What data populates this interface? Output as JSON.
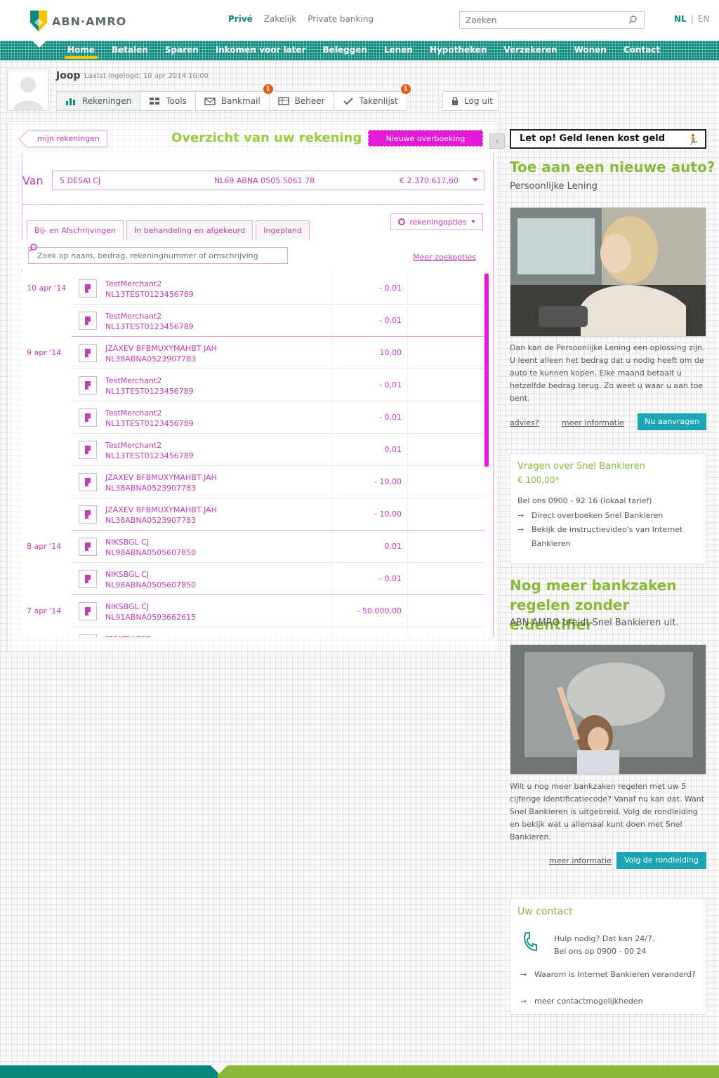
{
  "brand": {
    "name": "ABN·AMRO",
    "colors": {
      "teal": "#0a8a7d",
      "green": "#8ab93a",
      "magenta": "#c23bb7",
      "accent": "#e51ad8",
      "yellow": "#f5c400",
      "cta": "#1ba5b5"
    }
  },
  "segments": [
    "Privé",
    "Zakelijk",
    "Private banking"
  ],
  "search": {
    "placeholder": "Zoeken",
    "icon": "search-icon"
  },
  "lang": {
    "nl": "NL",
    "sep": "|",
    "en": "EN"
  },
  "mainnav": [
    "Home",
    "Betalen",
    "Sparen",
    "Inkomen voor later",
    "Beleggen",
    "Lenen",
    "Hypotheken",
    "Verzekeren",
    "Wonen",
    "Contact"
  ],
  "user": {
    "name": "Joop",
    "last_login": "Laatst ingelogd: 10 apr 2014 10:00"
  },
  "toolbar": [
    {
      "label": "Rekeningen",
      "icon": "bar-chart-icon",
      "badge": ""
    },
    {
      "label": "Tools",
      "icon": "grid-icon",
      "badge": ""
    },
    {
      "label": "Bankmail",
      "icon": "mail-icon",
      "badge": "1"
    },
    {
      "label": "Beheer",
      "icon": "table-icon",
      "badge": ""
    },
    {
      "label": "Takenlijst",
      "icon": "check-icon",
      "badge": "1"
    }
  ],
  "logout": {
    "label": "Log uit",
    "icon": "lock-icon"
  },
  "panel": {
    "back_label": "mijn rekeningen",
    "title": "Overzicht van uw rekening",
    "transfer_label": "Nieuwe overboeking",
    "van_label": "Van",
    "account": {
      "name": "S DESAI CJ",
      "iban": "NL69 ABNA 0505 5061 78",
      "balance": "€ 2.370.617,60"
    },
    "tabs": [
      "Bij- en Afschrijvingen",
      "In behandeling en afgekeurd",
      "Ingepland"
    ],
    "options_label": "rekeningopties",
    "filter_placeholder": "Zoek op naam, bedrag, rekeningnummer of omschrijving",
    "more_search": "Meer zoekopties"
  },
  "transactions": [
    {
      "date": "10 apr '14",
      "name": "TestMerchant2",
      "iban": "NL13TEST0123456789",
      "amount": "- 0,01"
    },
    {
      "date": "",
      "name": "TestMerchant2",
      "iban": "NL13TEST0123456789",
      "amount": "- 0,01"
    },
    {
      "date": "9 apr '14",
      "name": "JZAXEV BFBMUXYMAHBT JAH",
      "iban": "NL38ABNA0523907783",
      "amount": "10,00"
    },
    {
      "date": "",
      "name": "TestMerchant2",
      "iban": "NL13TEST0123456789",
      "amount": "- 0,01"
    },
    {
      "date": "",
      "name": "TestMerchant2",
      "iban": "NL13TEST0123456789",
      "amount": "- 0,01"
    },
    {
      "date": "",
      "name": "TestMerchant2",
      "iban": "NL13TEST0123456789",
      "amount": "0,01"
    },
    {
      "date": "",
      "name": "JZAXEV BFBMUXYMAHBT JAH",
      "iban": "NL38ABNA0523907783",
      "amount": "- 10,00"
    },
    {
      "date": "",
      "name": "JZAXEV BFBMUXYMAHBT JAH",
      "iban": "NL38ABNA0523907783",
      "amount": "- 10,00"
    },
    {
      "date": "8 apr '14",
      "name": "NIKSBGL CJ",
      "iban": "NL98ABNA0505607850",
      "amount": "0,01"
    },
    {
      "date": "",
      "name": "NIKSBGL CJ",
      "iban": "NL98ABNA0505607850",
      "amount": "- 0,01"
    },
    {
      "date": "7 apr '14",
      "name": "NIKSBGL CJ",
      "iban": "NL91ABNA0593662615",
      "amount": "- 50.000,00"
    },
    {
      "date": "",
      "name": "JZAXEV BFB",
      "iban": "",
      "amount": ""
    }
  ],
  "sidebar": {
    "warning": "Let op! Geld lenen kost geld",
    "auto_ad": {
      "title": "Toe aan een nieuwe auto?",
      "subtitle": "Persoonlijke Lening",
      "body": "Dan kan de Persoonlijke Lening een oplossing zijn. U leent alleen het bedrag dat u nodig heeft om de auto te kunnen kopen. Elke maand betaalt u hetzelfde bedrag terug. Zo weet u waar u aan toe bent.",
      "advies": "advies?",
      "meer": "meer informatie",
      "cta": "Nu aanvragen"
    },
    "snel_card": {
      "title": "Vragen over Snel Bankieren",
      "price": "€ 100,00*",
      "call": "Bel ons 0900 - 92 16 (lokaal tarief)",
      "links": [
        "Direct overboeken Snel Bankieren",
        "Bekijk de instructievideo's van Internet Bankieren"
      ]
    },
    "edentifier_ad": {
      "title": "Nog meer bankzaken regelen zonder e.dentifier",
      "subtitle": "ABN AMRO breidt Snel Bankieren uit.",
      "body": "Wilt u nog meer bankzaken regelen met uw 5 cijferige identificatiecode? Vanaf nu kan dat. Want Snel Bankieren is uitgebreid. Volg de rondleiding en bekijk wat u allemaal kunt doen met Snel Bankieren.",
      "meer": "meer informatie",
      "cta": "Volg de rondleiding"
    },
    "contact": {
      "title": "Uw contact",
      "help": "Hulp nodig? Dat kan 24/7.",
      "phone": "Bel ons op 0900 - 00 24",
      "links": [
        "Waarom is Internet Bankieren veranderd?",
        "meer contactmogelijkheden"
      ]
    }
  }
}
